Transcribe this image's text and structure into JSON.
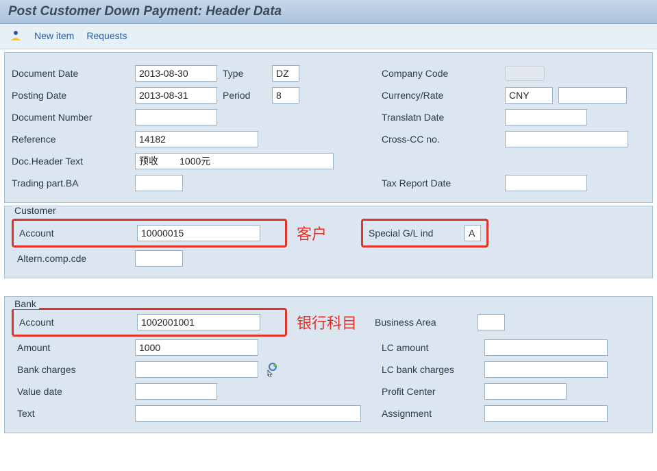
{
  "title": "Post Customer Down Payment: Header Data",
  "toolbar": {
    "new_item": "New item",
    "requests": "Requests"
  },
  "header": {
    "document_date_label": "Document Date",
    "document_date": "2013-08-30",
    "type_label": "Type",
    "type": "DZ",
    "company_code_label": "Company Code",
    "company_code": "",
    "posting_date_label": "Posting Date",
    "posting_date": "2013-08-31",
    "period_label": "Period",
    "period": "8",
    "currency_rate_label": "Currency/Rate",
    "currency": "CNY",
    "rate": "",
    "document_number_label": "Document Number",
    "document_number": "",
    "translatn_date_label": "Translatn Date",
    "translatn_date": "",
    "reference_label": "Reference",
    "reference": "14182",
    "cross_cc_label": "Cross-CC no.",
    "cross_cc": "",
    "doc_header_text_label": "Doc.Header Text",
    "doc_header_text": "预收        1000元",
    "trading_part_ba_label": "Trading part.BA",
    "trading_part_ba": "",
    "tax_report_date_label": "Tax Report Date",
    "tax_report_date": ""
  },
  "customer": {
    "legend": "Customer",
    "account_label": "Account",
    "account": "10000015",
    "special_gl_label": "Special G/L ind",
    "special_gl": "A",
    "altern_comp_cde_label": "Altern.comp.cde",
    "altern_comp_cde": "",
    "annotation": "客户"
  },
  "bank": {
    "legend": "Bank",
    "account_label": "Account",
    "account": "1002001001",
    "business_area_label": "Business Area",
    "business_area": "",
    "amount_label": "Amount",
    "amount": "1000",
    "lc_amount_label": "LC amount",
    "lc_amount": "",
    "bank_charges_label": "Bank charges",
    "bank_charges": "",
    "lc_bank_charges_label": "LC bank charges",
    "lc_bank_charges": "",
    "value_date_label": "Value date",
    "value_date": "",
    "profit_center_label": "Profit Center",
    "profit_center": "",
    "text_label": "Text",
    "text": "",
    "assignment_label": "Assignment",
    "assignment": "",
    "annotation": "银行科目"
  }
}
